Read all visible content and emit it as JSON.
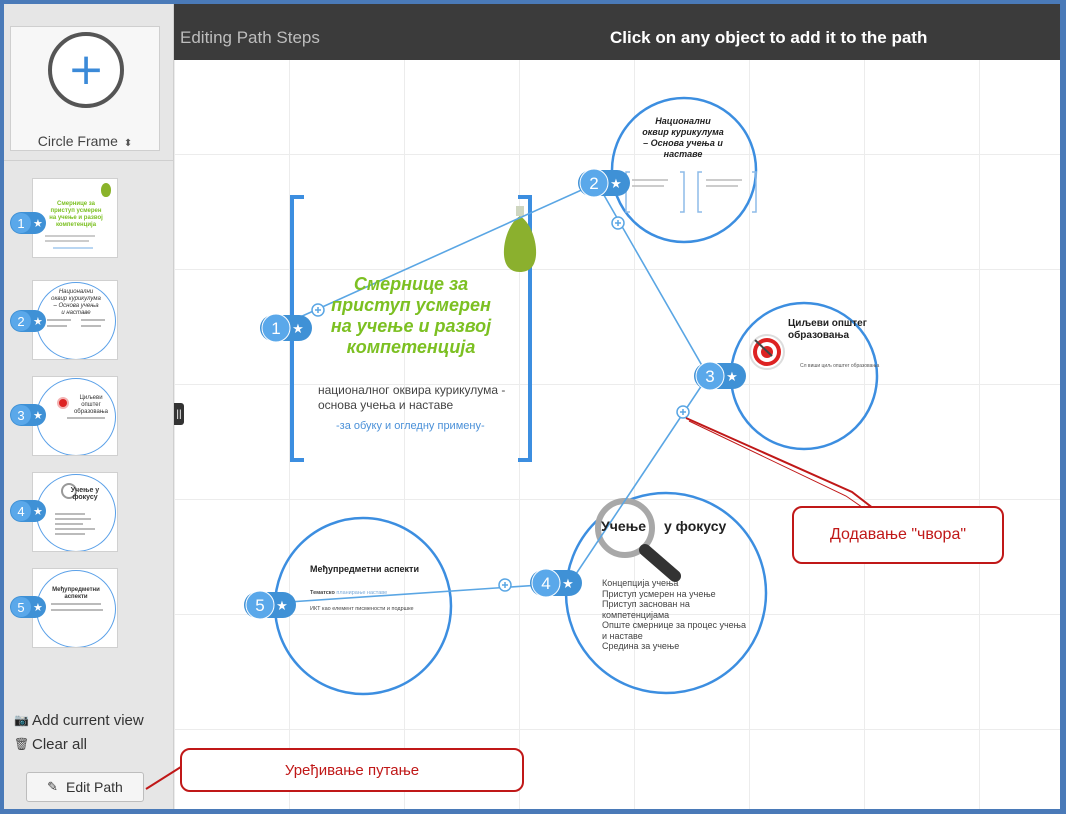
{
  "sidebar": {
    "frame_picker": {
      "label": "Circle Frame",
      "arrow": "⬍"
    },
    "thumbs": [
      {
        "num": "1",
        "title": "Смернице за приступ усмерен на учење и развој компетенција"
      },
      {
        "num": "2",
        "title": "Национални оквир курикулума – Основа учења и наставе"
      },
      {
        "num": "3",
        "title": "Циљеви општег образовања"
      },
      {
        "num": "4",
        "title": "Учење у фокусу"
      },
      {
        "num": "5",
        "title": "Међупредметни аспекти"
      }
    ],
    "add_current_view": "Add current view",
    "clear_all": "Clear all",
    "edit_path": "Edit Path"
  },
  "topbar": {
    "title": "Editing Path Steps",
    "hint": "Click on any object to add it to the path"
  },
  "canvas": {
    "main": {
      "title_l1": "Смернице за",
      "title_l2": "приступ усмерен",
      "title_l3": "на учење и развој",
      "title_l4": "компетенција",
      "sub_l1": "националног оквира курикулума -",
      "sub_l2": "основа учења и наставе",
      "link": "-за обуку и огледну примену-"
    },
    "node2": {
      "t1": "Национални",
      "t2": "оквир курикулума",
      "t3": "– Основа учења и",
      "t4": "наставе"
    },
    "node3": {
      "t1": "Циљеви општег",
      "t2": "образовања",
      "body": "Сл виши циљ општег образовања"
    },
    "node4": {
      "heading_word": "Учење",
      "heading_rest": "у фокусу",
      "items": [
        "Концепција учења",
        "Приступ усмерен на учење",
        "Приступ заснован на",
        "компетенцијама",
        "Опште смернице за процес учења",
        "и наставе",
        "Средина за учење"
      ]
    },
    "node5": {
      "title": "Међупредметни аспекти",
      "l1_bold": "Тематско",
      "l1_rest": " планирање наставе",
      "l2": "ИКТ као елемент писмености и подршке"
    },
    "path_nums": [
      "1",
      "2",
      "3",
      "4",
      "5"
    ]
  },
  "annotations": {
    "add_node": "Додавање \"чвора\"",
    "edit_path": "Уређивање путање"
  },
  "colors": {
    "accent": "#3f91d6",
    "callout": "#c01818",
    "topbar": "#3b3b3b",
    "frame": "#4a7ab8"
  }
}
